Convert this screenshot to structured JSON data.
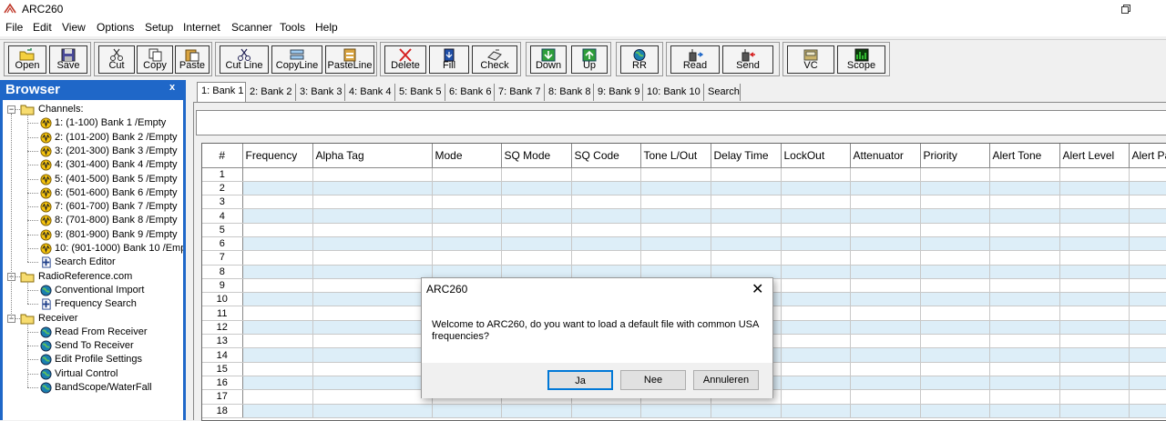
{
  "window": {
    "title": "ARC260"
  },
  "menu": [
    "File",
    "Edit",
    "View",
    "Options",
    "Setup",
    "Internet",
    "Scanner",
    "Tools",
    "Help"
  ],
  "toolbar": [
    {
      "label": "Open",
      "icon": "open-folder-icon"
    },
    {
      "label": "Save",
      "icon": "floppy-disk-icon"
    },
    {
      "label": "Cut",
      "icon": "scissors-icon"
    },
    {
      "label": "Copy",
      "icon": "copy-icon"
    },
    {
      "label": "Paste",
      "icon": "paste-icon"
    },
    {
      "label": "Cut Line",
      "icon": "cut-line-icon"
    },
    {
      "label": "CopyLine",
      "icon": "copy-line-icon"
    },
    {
      "label": "PasteLine",
      "icon": "paste-line-icon"
    },
    {
      "label": "Delete",
      "icon": "red-x-icon"
    },
    {
      "label": "Fill",
      "icon": "fill-icon"
    },
    {
      "label": "Check",
      "icon": "check-icon"
    },
    {
      "label": "Down",
      "icon": "green-down-arrow-icon"
    },
    {
      "label": "Up",
      "icon": "green-up-arrow-icon"
    },
    {
      "label": "RR",
      "icon": "globe-icon"
    },
    {
      "label": "Read",
      "icon": "read-radio-icon"
    },
    {
      "label": "Send",
      "icon": "send-radio-icon"
    },
    {
      "label": "VC",
      "icon": "virtual-control-icon"
    },
    {
      "label": "Scope",
      "icon": "scope-icon"
    }
  ],
  "browser": {
    "title": "Browser",
    "close": "x",
    "tree": [
      {
        "label": "Channels:",
        "level": 0,
        "type": "folder"
      },
      {
        "label": "1: (1-100) Bank 1  /Empty",
        "level": 1,
        "type": "bank"
      },
      {
        "label": "2: (101-200) Bank 2  /Empty",
        "level": 1,
        "type": "bank"
      },
      {
        "label": "3: (201-300) Bank 3  /Empty",
        "level": 1,
        "type": "bank"
      },
      {
        "label": "4: (301-400) Bank 4  /Empty",
        "level": 1,
        "type": "bank"
      },
      {
        "label": "5: (401-500) Bank 5  /Empty",
        "level": 1,
        "type": "bank"
      },
      {
        "label": "6: (501-600) Bank 6  /Empty",
        "level": 1,
        "type": "bank"
      },
      {
        "label": "7: (601-700) Bank 7  /Empty",
        "level": 1,
        "type": "bank"
      },
      {
        "label": "8: (701-800) Bank 8  /Empty",
        "level": 1,
        "type": "bank"
      },
      {
        "label": "9: (801-900) Bank 9  /Empty",
        "level": 1,
        "type": "bank"
      },
      {
        "label": "10: (901-1000) Bank 10  /Emp",
        "level": 1,
        "type": "bank"
      },
      {
        "label": "Search Editor",
        "level": 1,
        "type": "search"
      },
      {
        "label": "RadioReference.com",
        "level": 0,
        "type": "folder"
      },
      {
        "label": "Conventional Import",
        "level": 1,
        "type": "globe"
      },
      {
        "label": "Frequency Search",
        "level": 1,
        "type": "search"
      },
      {
        "label": "Receiver",
        "level": 0,
        "type": "folder"
      },
      {
        "label": "Read From Receiver",
        "level": 1,
        "type": "globe"
      },
      {
        "label": "Send To Receiver",
        "level": 1,
        "type": "globe"
      },
      {
        "label": "Edit Profile Settings",
        "level": 1,
        "type": "globe"
      },
      {
        "label": "Virtual Control",
        "level": 1,
        "type": "globe"
      },
      {
        "label": "BandScope/WaterFall",
        "level": 1,
        "type": "globe"
      }
    ]
  },
  "tabs": [
    "1: Bank 1",
    "2: Bank 2",
    "3: Bank 3",
    "4: Bank 4",
    "5: Bank 5",
    "6: Bank 6",
    "7: Bank 7",
    "8: Bank 8",
    "9: Bank 9",
    "10: Bank 10",
    "Search"
  ],
  "grid": {
    "columns": [
      "#",
      "Frequency",
      "Alpha Tag",
      "Mode",
      "SQ Mode",
      "SQ Code",
      "Tone L/Out",
      "Delay Time",
      "LockOut",
      "Attenuator",
      "Priority",
      "Alert Tone",
      "Alert Level",
      "Alert Pat"
    ],
    "rows": [
      "1",
      "2",
      "3",
      "4",
      "5",
      "6",
      "7",
      "8",
      "9",
      "10",
      "11",
      "12",
      "13",
      "14",
      "15",
      "16",
      "17",
      "18"
    ]
  },
  "dialog": {
    "title": "ARC260",
    "close": "✕",
    "message": "Welcome to ARC260, do you want to load a default file with common USA frequencies?",
    "buttons": [
      "Ja",
      "Nee",
      "Annuleren"
    ]
  }
}
